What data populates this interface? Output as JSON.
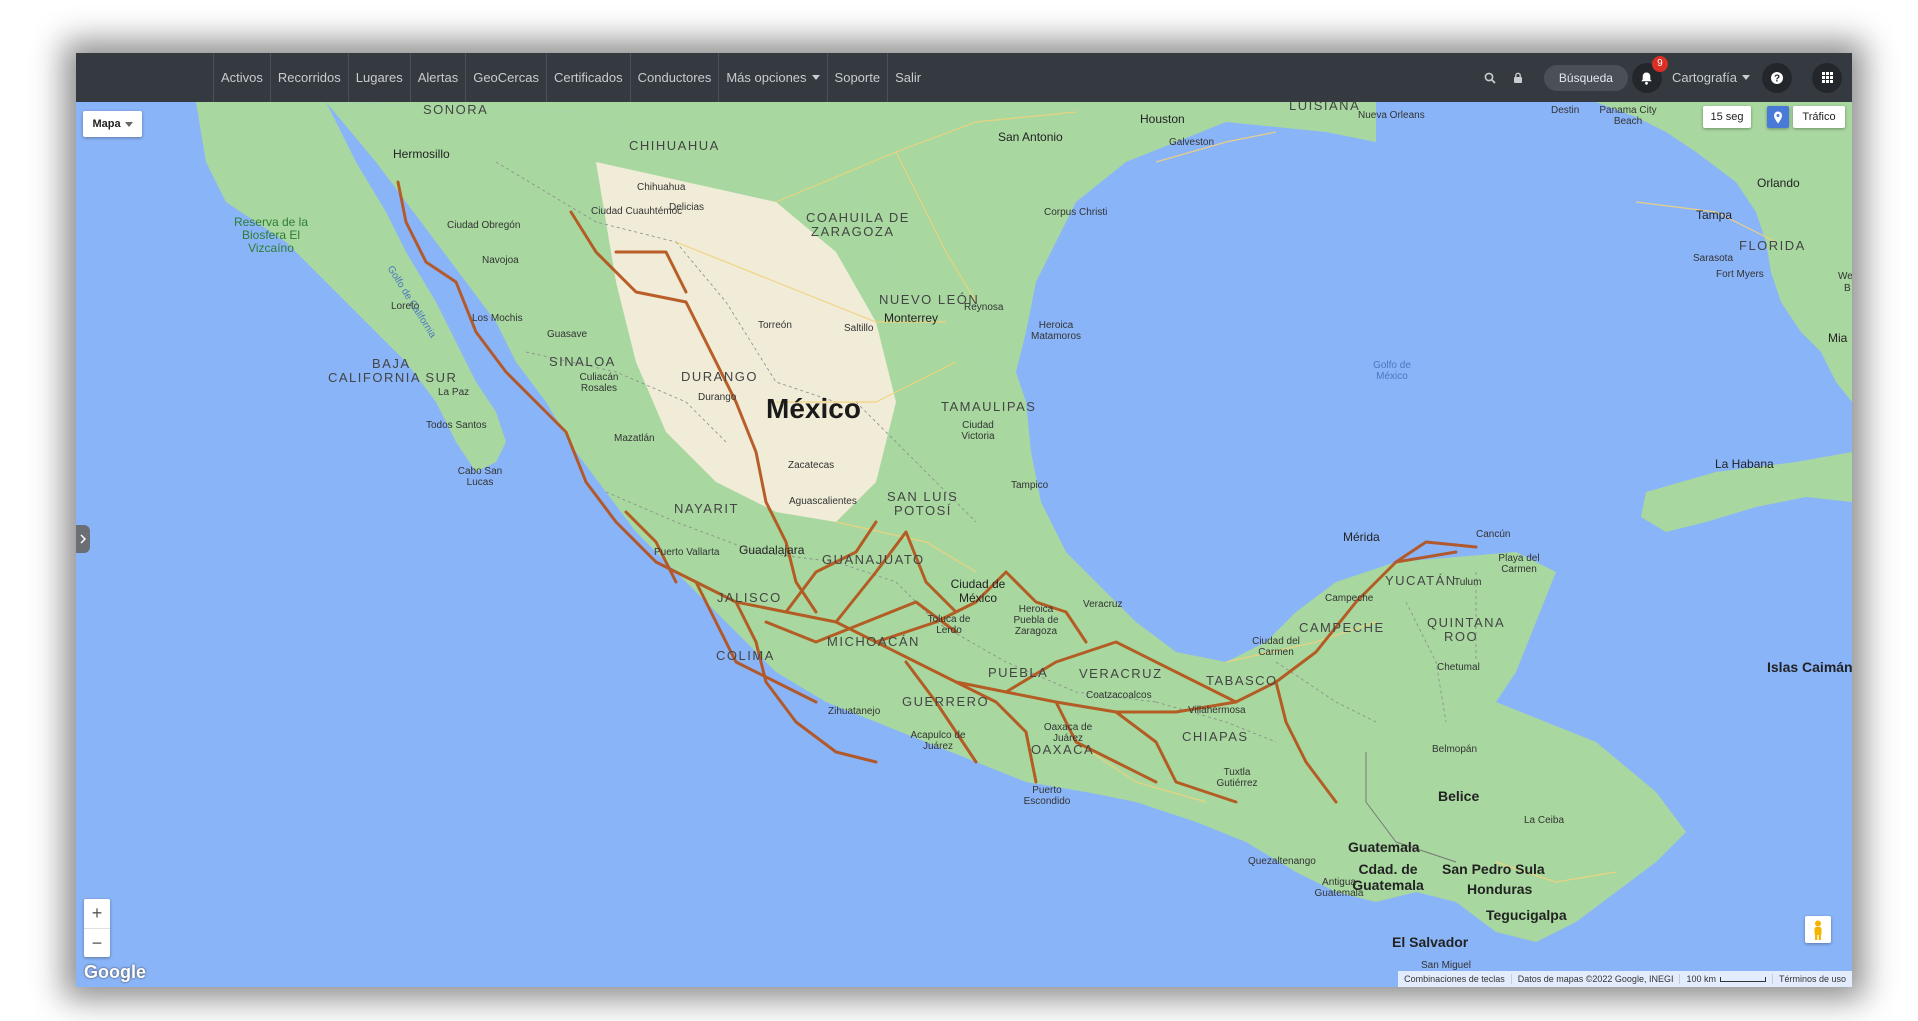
{
  "navbar": {
    "items": [
      {
        "label": "Activos"
      },
      {
        "label": "Recorridos"
      },
      {
        "label": "Lugares"
      },
      {
        "label": "Alertas"
      },
      {
        "label": "GeoCercas"
      },
      {
        "label": "Certificados"
      },
      {
        "label": "Conductores"
      },
      {
        "label": "Más opciones",
        "dropdown": true
      },
      {
        "label": "Soporte"
      },
      {
        "label": "Salir"
      }
    ],
    "search_label": "Búsqueda",
    "notification_count": "9",
    "cartography_label": "Cartografía",
    "icons": [
      "search-icon",
      "lock-icon",
      "bell-icon",
      "help-icon",
      "apps-grid-icon"
    ]
  },
  "map": {
    "type_selector": "Mapa",
    "refresh_interval": "15 seg",
    "traffic_label": "Tráfico",
    "zoom_in": "+",
    "zoom_out": "−",
    "logo": "Google",
    "attribution": {
      "shortcuts": "Combinaciones de teclas",
      "data": "Datos de mapas ©2022 Google, INEGI",
      "scale": "100 km",
      "terms": "Términos de uso"
    },
    "labels": {
      "country": "México",
      "states": [
        "SONORA",
        "CHIHUAHUA",
        "COAHUILA DE",
        "ZARAGOZA",
        "NUEVO LEÓN",
        "BAJA",
        "CALIFORNIA SUR",
        "SINALOA",
        "DURANGO",
        "TAMAULIPAS",
        "NAYARIT",
        "SAN LUIS",
        "POTOSÍ",
        "GUANAJUATO",
        "JALISCO",
        "MICHOACÁN",
        "COLIMA",
        "GUERRERO",
        "PUEBLA",
        "VERACRUZ",
        "OAXACA",
        "TABASCO",
        "CHIAPAS",
        "CAMPECHE",
        "YUCATÁN",
        "QUINTANA",
        "ROO"
      ],
      "cities": [
        "Hermosillo",
        "Chihuahua",
        "Delicias",
        "Ciudad Cuauhtémoc",
        "Ciudad Obregón",
        "Navojoa",
        "Los Mochis",
        "Guasave",
        "Culiacán Rosales",
        "Mazatlán",
        "Loreto",
        "La Paz",
        "Todos Santos",
        "Cabo San Lucas",
        "Torreón",
        "Saltillo",
        "Monterrey",
        "Reynosa",
        "Heroica Matamoros",
        "Durango",
        "Zacatecas",
        "Ciudad Victoria",
        "Tampico",
        "Aguascalientes",
        "Puerto Vallarta",
        "Guadalajara",
        "Ciudad de México",
        "Toluca de Lerdo",
        "Heroica Puebla de Zaragoza",
        "Veracruz",
        "Coatzacoalcos",
        "Villahermosa",
        "Zihuatanejo",
        "Acapulco de Juárez",
        "Oaxaca de Juárez",
        "Puerto Escondido",
        "Tuxtla Gutiérrez",
        "Mérida",
        "Campeche",
        "Cancún",
        "Playa del Carmen",
        "Tulum",
        "Chetumal",
        "Ciudad del Carmen",
        "San Antonio",
        "Houston",
        "Galveston",
        "Corpus Christi",
        "Nueva Orleans",
        "Destin",
        "Panama City Beach",
        "Orlando",
        "Tampa",
        "Sarasota",
        "Fort Myers",
        "La Habana",
        "Belmopán",
        "Quezaltenango",
        "Antigua Guatemala",
        "La Ceiba",
        "San Miguel"
      ],
      "big_places": [
        "Belice",
        "Guatemala",
        "Cdad. de Guatemala",
        "San Pedro Sula",
        "Honduras",
        "Tegucigalpa",
        "El Salvador",
        "Islas Caimán"
      ],
      "us_state": "FLORIDA",
      "us_louisiana": "LUISIANA",
      "sea": "Golfo de México",
      "gulf_cal": "Golfo de California",
      "park": "Reserva de la Biosfera El Vizcaíno",
      "cut_labels": [
        "Wes",
        "B",
        "Mia"
      ]
    }
  },
  "colors": {
    "navbar_bg": "#343a40",
    "water": "#a9c8f0",
    "land": "#a8d8a0",
    "land_light": "#f3efdc",
    "route": "#b5521a"
  }
}
